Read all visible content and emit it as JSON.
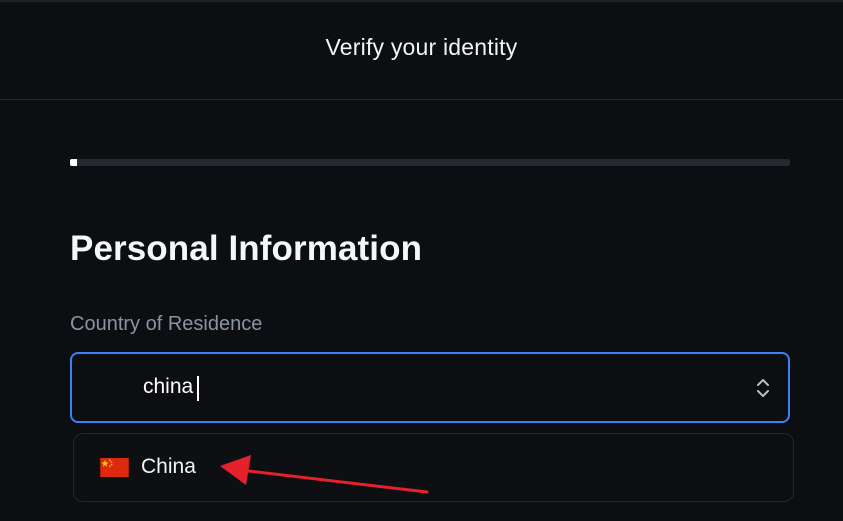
{
  "header": {
    "title": "Verify your identity"
  },
  "progress": {
    "fraction": 0.01
  },
  "form": {
    "section_title": "Personal Information",
    "country_field": {
      "label": "Country of Residence",
      "value": "china",
      "control_icon": "chevron-up-down-icon"
    },
    "dropdown_options": [
      {
        "label": "China",
        "icon": "china-flag-icon"
      }
    ]
  },
  "annotation": {
    "type": "arrow",
    "color": "#e5222b",
    "points_to": "China"
  },
  "colors": {
    "background": "#0c0e12",
    "accent": "#3b82f6",
    "label": "#8b93a3"
  }
}
